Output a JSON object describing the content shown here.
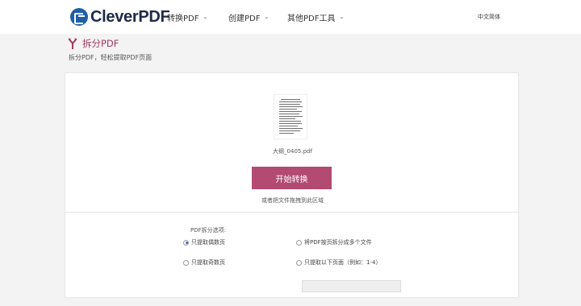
{
  "header": {
    "logo_text": "CleverPDF",
    "nav": [
      {
        "label": "转换PDF"
      },
      {
        "label": "创建PDF"
      },
      {
        "label": "其他PDF工具"
      }
    ],
    "language": "中文简体"
  },
  "page": {
    "title": "拆分PDF",
    "subtitle": "拆分PDF，轻松提取PDF页面",
    "accent_color": "#a5385f"
  },
  "upload": {
    "filename": "大纲_0405.pdf",
    "start_button": "开始转换",
    "drop_hint": "或者把文件拖拽到此区域",
    "button_color": "#b24a72"
  },
  "options": {
    "label": "PDF拆分选项:",
    "radios": [
      {
        "label": "只提取偶数页",
        "selected": true
      },
      {
        "label": "将PDF按页拆分成多个文件",
        "selected": false
      },
      {
        "label": "只提取奇数页",
        "selected": false
      },
      {
        "label": "只提取以下页面（例如：1-4）",
        "selected": false
      }
    ],
    "range_value": ""
  }
}
